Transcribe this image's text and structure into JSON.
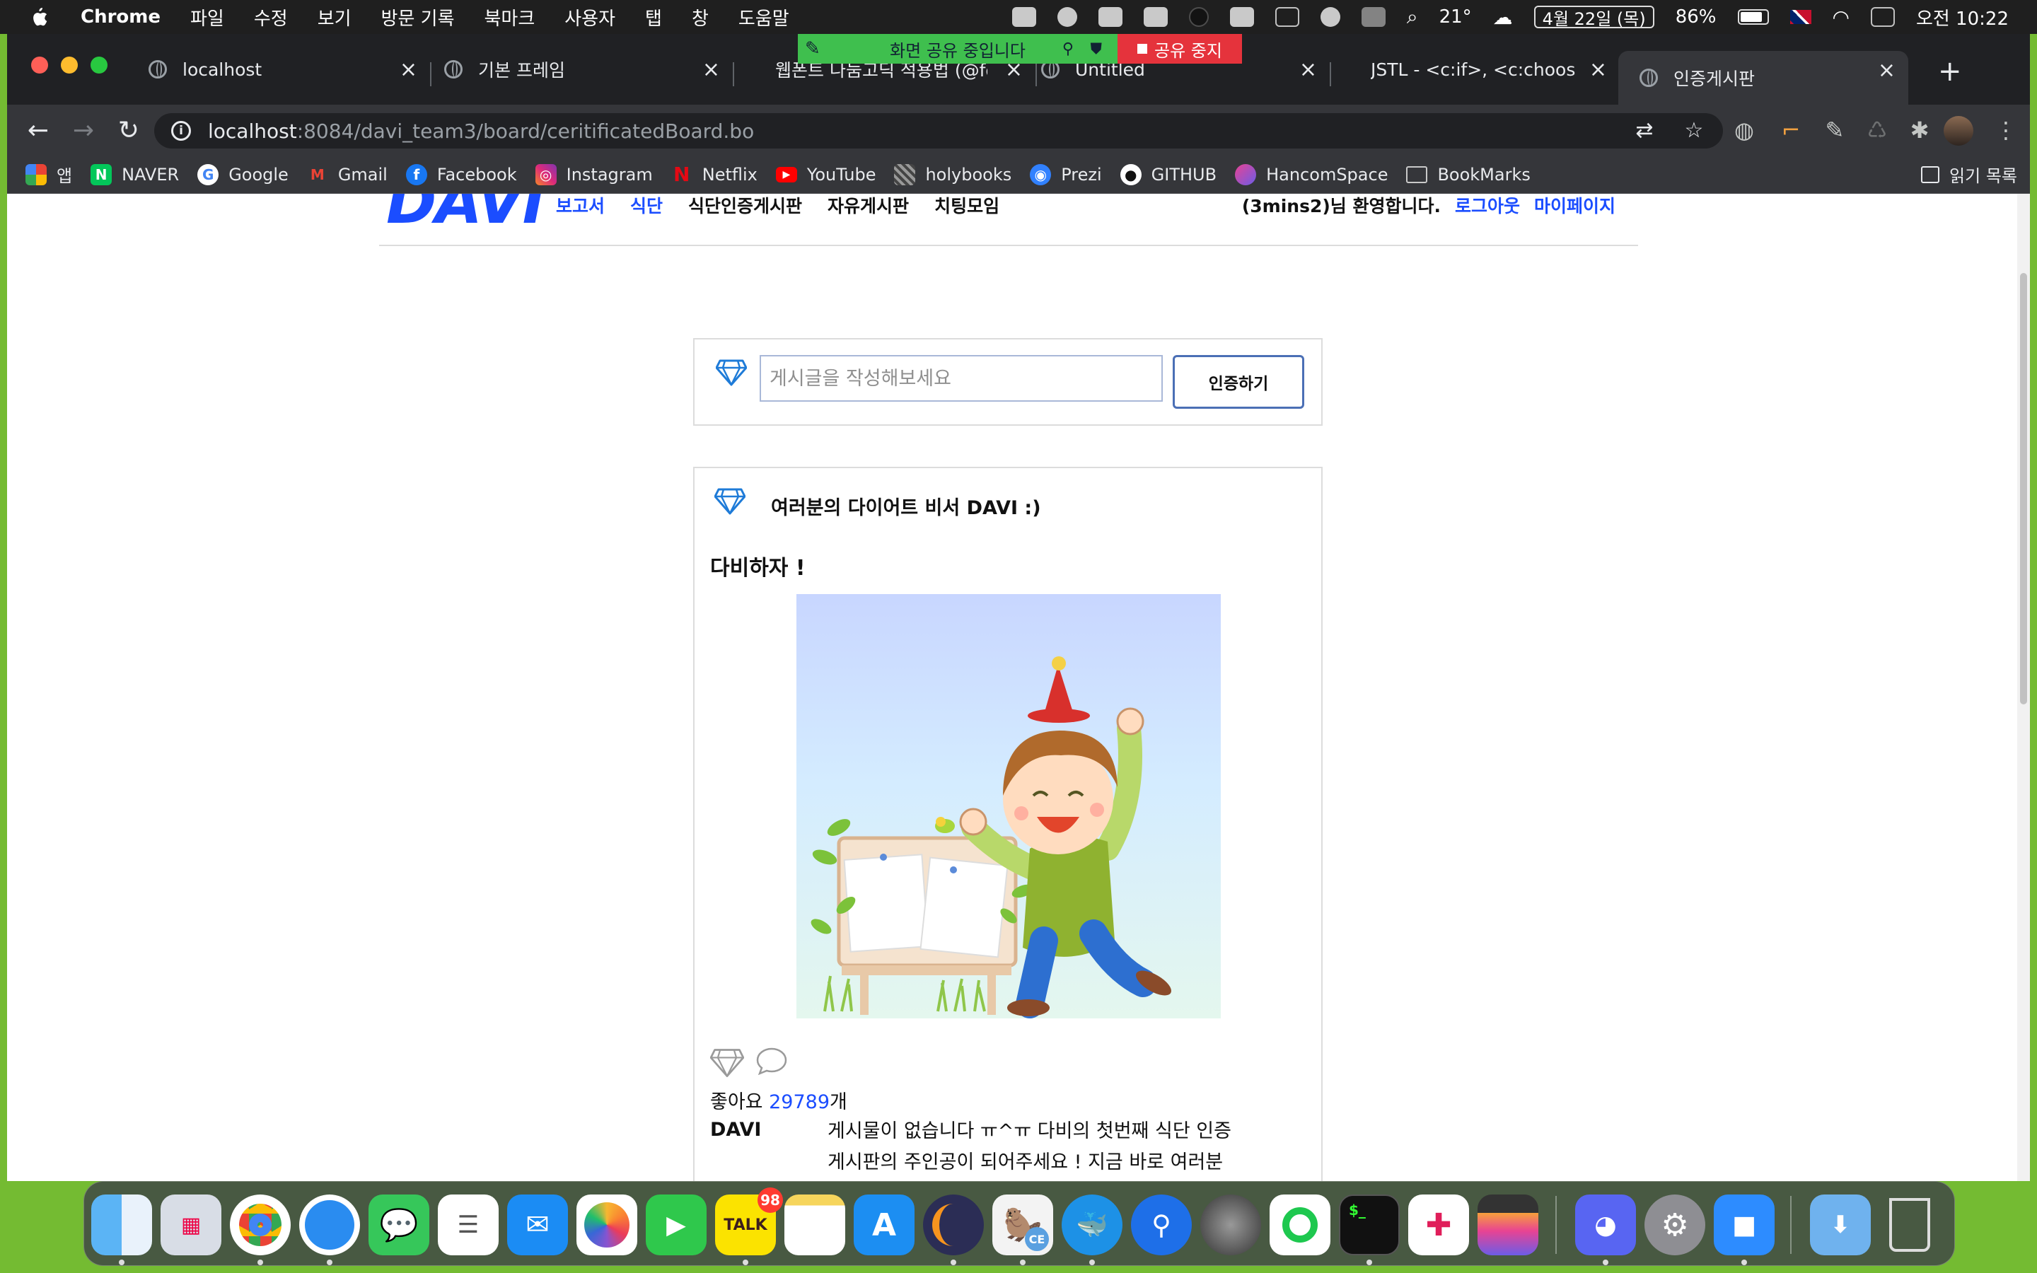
{
  "menubar": {
    "app_name": "Chrome",
    "items": [
      "파일",
      "수정",
      "보기",
      "방문 기록",
      "북마크",
      "사용자",
      "탭",
      "창",
      "도움말"
    ],
    "temperature": "21°",
    "date": "4월 22일 (목)",
    "battery": "86%",
    "time": "오전 10:22"
  },
  "screenshare": {
    "status_label": "화면 공유 중입니다",
    "stop_label": "공유 중지"
  },
  "tabs": [
    {
      "title": "localhost"
    },
    {
      "title": "기본 프레임"
    },
    {
      "title": "웹폰트 나눔고딕 적용법 (@fo"
    },
    {
      "title": "Untitled"
    },
    {
      "title": "JSTL - <c:if>, <c:choose>"
    },
    {
      "title": "인증게시판",
      "active": true
    }
  ],
  "address": {
    "host": "localhost",
    "path": ":8084/davi_team3/board/ceritificatedBoard.bo"
  },
  "bookmarks": [
    {
      "label": "앱",
      "icon": "apps-grid-icon",
      "color": "#e8453c"
    },
    {
      "label": "NAVER",
      "icon": "naver-icon",
      "color": "#03c75a"
    },
    {
      "label": "Google",
      "icon": "google-icon",
      "color": "#ffffff"
    },
    {
      "label": "Gmail",
      "icon": "gmail-icon",
      "color": "#ea4335"
    },
    {
      "label": "Facebook",
      "icon": "facebook-icon",
      "color": "#1877f2"
    },
    {
      "label": "Instagram",
      "icon": "instagram-icon",
      "color": "#c13584"
    },
    {
      "label": "Netflix",
      "icon": "netflix-icon",
      "color": "#e50914"
    },
    {
      "label": "YouTube",
      "icon": "youtube-icon",
      "color": "#ff0000"
    },
    {
      "label": "holybooks",
      "icon": "holybooks-icon",
      "color": "#999999"
    },
    {
      "label": "Prezi",
      "icon": "prezi-icon",
      "color": "#3181ff"
    },
    {
      "label": "GITHUB",
      "icon": "github-icon",
      "color": "#ffffff"
    },
    {
      "label": "HancomSpace",
      "icon": "hancom-icon",
      "color": "#8e44ad"
    },
    {
      "label": "BookMarks",
      "icon": "folder-icon",
      "color": "#c9c9c9"
    }
  ],
  "reading_list_label": "읽기 목록",
  "site": {
    "logo": "DAVI",
    "nav": [
      "보고서",
      "식단",
      "식단인증게시판",
      "자유게시판",
      "치팅모임"
    ],
    "welcome": "(3mins2)님 환영합니다.",
    "logout": "로그아웃",
    "mypage": "마이페이지",
    "accent": "#1b4dff"
  },
  "write": {
    "placeholder": "게시글을 작성해보세요",
    "button": "인증하기"
  },
  "post": {
    "author": "여러분의 다이어트 비서 DAVI :)",
    "title": "다비하자 !",
    "likes_prefix": "좋아요 ",
    "likes_count": "29789",
    "likes_suffix": "개",
    "comment_author": "DAVI",
    "comment_text": "게시물이 없습니다 ㅠ^ㅠ 다비의 첫번째 식단 인증게시판의 주인공이 되어주세요 ! 지금 바로 여러분의 식단을 인증해주세요!"
  },
  "dock": {
    "talk_badge": "98",
    "talk_label": "TALK",
    "ce_label": "CE"
  }
}
